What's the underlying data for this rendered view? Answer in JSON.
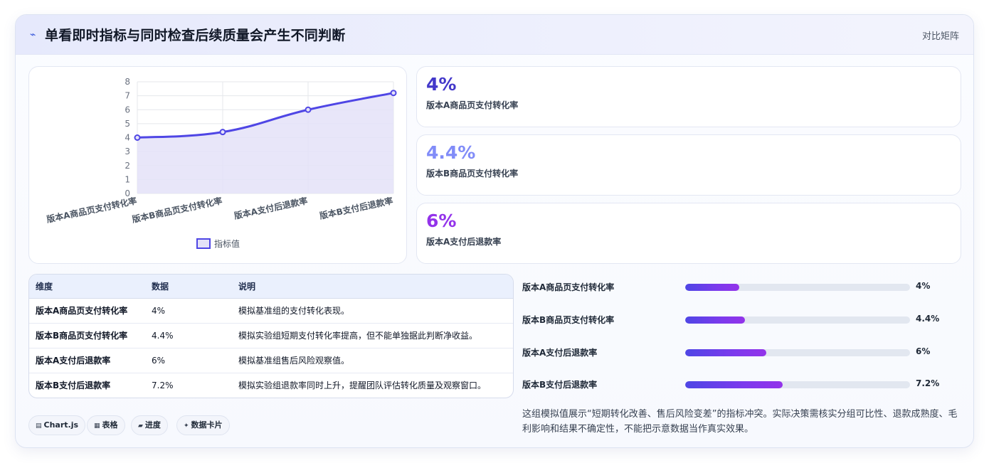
{
  "header": {
    "title": "单看即时指标与同时检查后续质量会产生不同判断",
    "icon": "pulse-icon",
    "mode_label": "对比矩阵"
  },
  "chart_data": {
    "type": "line",
    "categories": [
      "版本A商品页支付转化率",
      "版本B商品页支付转化率",
      "版本A支付后退款率",
      "版本B支付后退款率"
    ],
    "series": [
      {
        "name": "指标值",
        "values": [
          4,
          4.4,
          6,
          7.2
        ]
      }
    ],
    "ylim": [
      0,
      8
    ],
    "yticks": [
      "0",
      "1",
      "2",
      "3",
      "4",
      "5",
      "6",
      "7",
      "8"
    ],
    "grid": true,
    "legend": "bottom",
    "colors": {
      "line": "#4f46e5",
      "fill": "#e4e2f8"
    }
  },
  "kpis": [
    {
      "value": "4%",
      "label": "版本A商品页支付转化率",
      "color": "#4338ca"
    },
    {
      "value": "4.4%",
      "label": "版本B商品页支付转化率",
      "color": "#818cf8"
    },
    {
      "value": "6%",
      "label": "版本A支付后退款率",
      "color": "#9333ea"
    }
  ],
  "table": {
    "headers": [
      "维度",
      "数据",
      "说明"
    ],
    "rows": [
      [
        "版本A商品页支付转化率",
        "4%",
        "模拟基准组的支付转化表现。"
      ],
      [
        "版本B商品页支付转化率",
        "4.4%",
        "模拟实验组短期支付转化率提高，但不能单独据此判断净收益。"
      ],
      [
        "版本A支付后退款率",
        "6%",
        "模拟基准组售后风险观察值。"
      ],
      [
        "版本B支付后退款率",
        "7.2%",
        "模拟实验组退款率同时上升，提醒团队评估转化质量及观察窗口。"
      ]
    ]
  },
  "progress": [
    {
      "label": "版本A商品页支付转化率",
      "value_text": "4%",
      "fraction": 0.24
    },
    {
      "label": "版本B商品页支付转化率",
      "value_text": "4.4%",
      "fraction": 0.265
    },
    {
      "label": "版本A支付后退款率",
      "value_text": "6%",
      "fraction": 0.36
    },
    {
      "label": "版本B支付后退款率",
      "value_text": "7.2%",
      "fraction": 0.435
    }
  ],
  "note": "这组模拟值展示“短期转化改善、售后风险变差”的指标冲突。实际决策需核实分组可比性、退款成熟度、毛利影响和结果不确定性，不能把示意数据当作真实效果。",
  "tags": [
    {
      "icon": "chart-icon",
      "glyph": "▤",
      "label": "Chart.js"
    },
    {
      "icon": "table-icon",
      "glyph": "▦",
      "label": "表格"
    },
    {
      "icon": "progress-icon",
      "glyph": "▰",
      "label": "进度"
    },
    {
      "icon": "sparkle-icon",
      "glyph": "✦",
      "label": "数据卡片"
    }
  ]
}
